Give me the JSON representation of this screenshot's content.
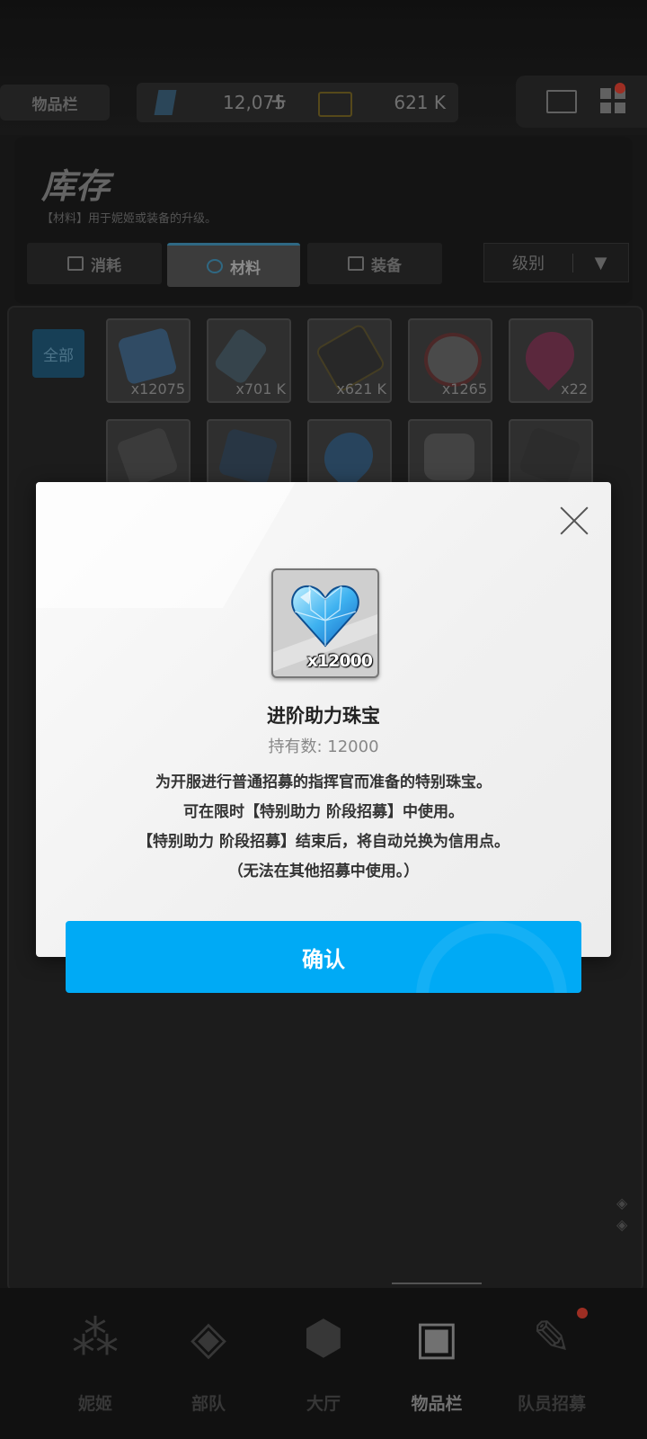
{
  "header": {
    "inventory_tab": "物品栏",
    "gems": "12,075",
    "gems_plus": "+",
    "credits": "621 K"
  },
  "panel": {
    "title": "库存",
    "subtitle": "【材料】用于妮姬或装备的升级。",
    "tabs": [
      "消耗",
      "材料",
      "装备"
    ],
    "active_tab": "材料",
    "sort_label": "级别",
    "sort_chevron": "▼"
  },
  "grid": {
    "filter_all": "全部",
    "items": [
      {
        "count": "x12075",
        "icon": "gem-crystal-icon"
      },
      {
        "count": "x701 K",
        "icon": "usb-drive-icon"
      },
      {
        "count": "x621 K",
        "icon": "credit-card-icon"
      },
      {
        "count": "x1265",
        "icon": "core-orb-icon"
      },
      {
        "count": "x22",
        "icon": "pink-heart-gem-icon"
      },
      {
        "count": "",
        "icon": "ticket-icon"
      },
      {
        "count": "",
        "icon": "tablet-icon"
      },
      {
        "count": "",
        "icon": "blue-heart-gem-icon"
      },
      {
        "count": "",
        "icon": "dna-hex-icon"
      },
      {
        "count": "",
        "icon": "fan-card-icon"
      }
    ]
  },
  "modal": {
    "item_name": "进阶助力珠宝",
    "owned_label": "持有数: 12000",
    "quantity": "x12000",
    "description": [
      "为开服进行普通招募的指挥官而准备的特别珠宝。",
      "可在限时【特别助力 阶段招募】中使用。",
      "【特别助力 阶段招募】结束后，将自动兑换为信用点。",
      "（无法在其他招募中使用。）"
    ],
    "confirm": "确认"
  },
  "nav": {
    "items": [
      {
        "label": "妮姬",
        "icon": "nikke-group-icon"
      },
      {
        "label": "部队",
        "icon": "squad-icon"
      },
      {
        "label": "大厅",
        "icon": "lobby-icon"
      },
      {
        "label": "物品栏",
        "icon": "inventory-icon"
      },
      {
        "label": "队员招募",
        "icon": "recruit-icon"
      }
    ],
    "active": "物品栏"
  },
  "colors": {
    "accent": "#00aaf5",
    "notification": "#c0392b"
  }
}
